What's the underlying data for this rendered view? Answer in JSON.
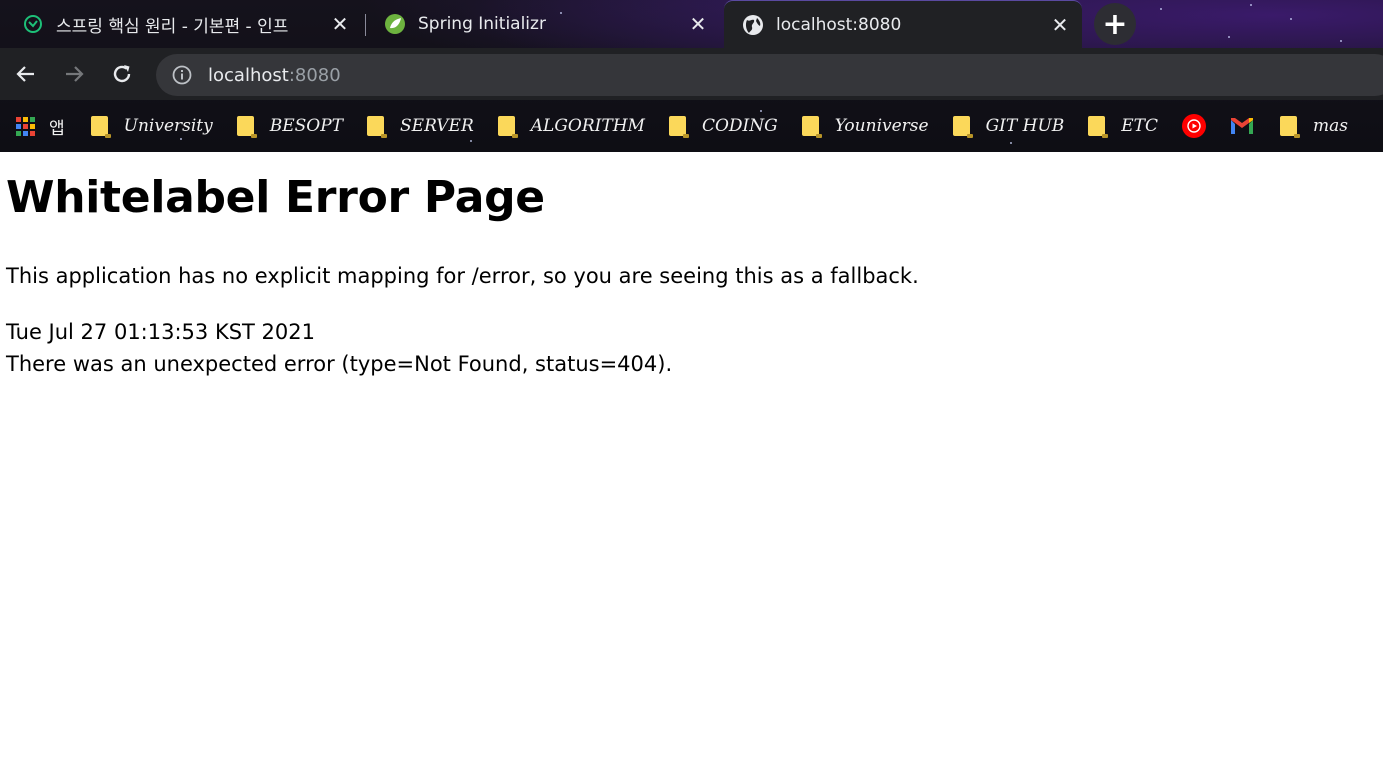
{
  "browser": {
    "tabs": [
      {
        "title": "스프링 핵심 원리 - 기본편 - 인프",
        "favicon": "inflearn-icon",
        "active": false
      },
      {
        "title": "Spring Initializr",
        "favicon": "spring-leaf-icon",
        "active": false
      },
      {
        "title": "localhost:8080",
        "favicon": "globe-icon",
        "active": true
      }
    ],
    "close_glyph": "✕",
    "new_tab_glyph": "+",
    "address": {
      "host": "localhost",
      "port": ":8080"
    },
    "bookmarks": {
      "apps_label": "앱",
      "folders": [
        "University",
        "BESOPT",
        "SERVER",
        "ALGORITHM",
        "CODING",
        "Youniverse",
        "GIT HUB",
        "ETC"
      ],
      "trailing_folder": "mas"
    },
    "colors": {
      "folder": "#fbd85a",
      "youtube": "#ff0000",
      "chrome_dark": "#202124"
    }
  },
  "page": {
    "heading": "Whitelabel Error Page",
    "message": "This application has no explicit mapping for /error, so you are seeing this as a fallback.",
    "timestamp": "Tue Jul 27 01:13:53 KST 2021",
    "error_detail": "There was an unexpected error (type=Not Found, status=404)."
  }
}
